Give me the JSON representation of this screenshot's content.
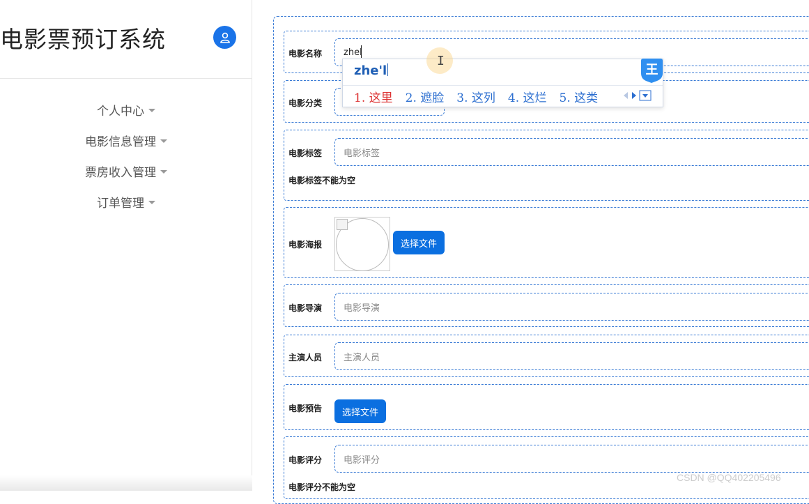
{
  "app": {
    "title": "电影票预订系统"
  },
  "sidebar": {
    "items": [
      {
        "label": "个人中心"
      },
      {
        "label": "电影信息管理"
      },
      {
        "label": "票房收入管理"
      },
      {
        "label": "订单管理"
      }
    ]
  },
  "form": {
    "name": {
      "label": "电影名称",
      "value": "zhel"
    },
    "category": {
      "label": "电影分类"
    },
    "tags": {
      "label": "电影标签",
      "placeholder": "电影标签",
      "error": "电影标签不能为空"
    },
    "poster": {
      "label": "电影海报",
      "button": "选择文件"
    },
    "director": {
      "label": "电影导演",
      "placeholder": "电影导演"
    },
    "cast": {
      "label": "主演人员",
      "placeholder": "主演人员"
    },
    "trailer": {
      "label": "电影预告",
      "button": "选择文件"
    },
    "rating": {
      "label": "电影评分",
      "placeholder": "电影评分",
      "error": "电影评分不能为空"
    }
  },
  "ime": {
    "composition": "zhe'l",
    "candidates": [
      "1. 这里",
      "2. 遮脸",
      "3. 这列",
      "4. 这烂",
      "5. 这类"
    ],
    "logo_text": "王"
  },
  "watermark": "CSDN @QQ402205496",
  "colors": {
    "accent": "#0b6fe0",
    "dashed_border": "#3a7bd5",
    "candidate_first": "#dd3333",
    "candidate": "#2d6fd0"
  }
}
